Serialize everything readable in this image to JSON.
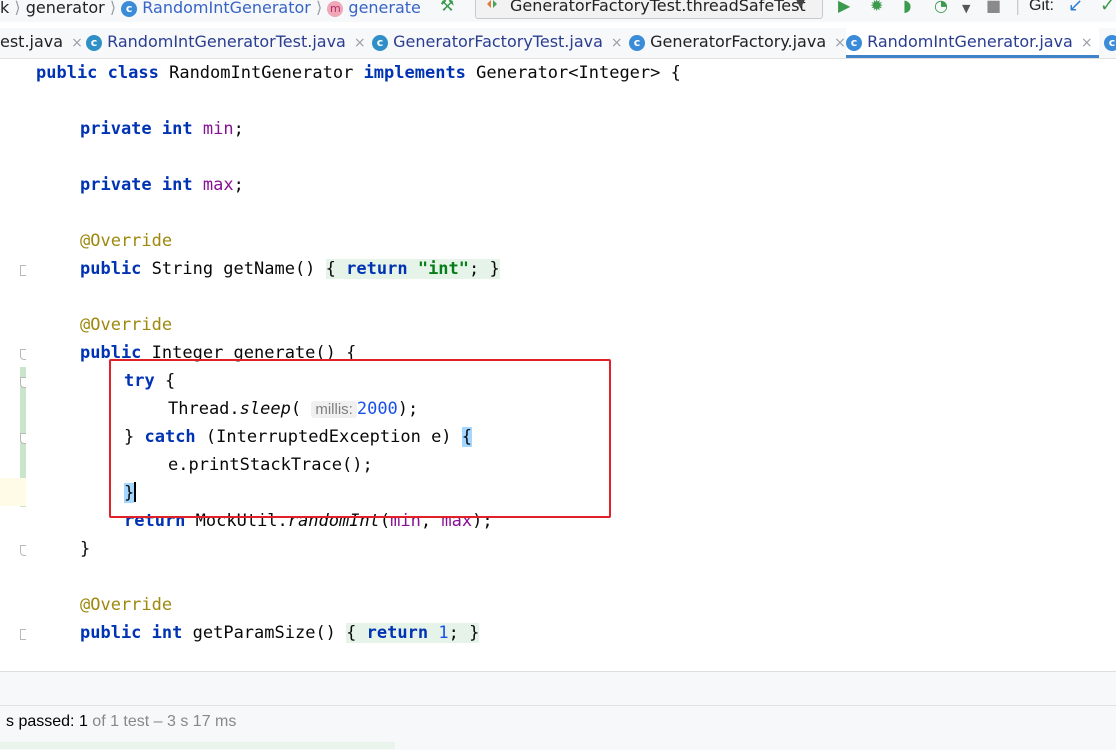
{
  "breadcrumb": {
    "prefix": "k",
    "items": [
      "generator",
      "RandomIntGenerator",
      "generate"
    ],
    "class_badge": "c",
    "method_badge": "m"
  },
  "toolbar": {
    "run_config": "GeneratorFactoryTest.threadSafeTest",
    "vcs_label": "Git:"
  },
  "tabs": [
    {
      "label": "est.java",
      "close": "×"
    },
    {
      "label": "RandomIntGeneratorTest.java",
      "close": "×"
    },
    {
      "label": "GeneratorFactoryTest.java",
      "close": "×"
    },
    {
      "label": "GeneratorFactory.java",
      "close": "×"
    },
    {
      "label": "RandomIntGenerator.java",
      "close": "×"
    }
  ],
  "code": {
    "class_decl": {
      "kw1": "public",
      "kw2": "class",
      "name": " RandomIntGenerator ",
      "kw3": "implements",
      "rest": " Generator<Integer> {"
    },
    "min_decl": {
      "kw1": "private",
      "kw2": "int",
      "field": "min",
      "end": ";"
    },
    "max_decl": {
      "kw1": "private",
      "kw2": "int",
      "field": "max",
      "end": ";"
    },
    "override": "@Override",
    "get_name": {
      "kw1": "public",
      "type": " String getName() ",
      "open": "{",
      "kw2": "return",
      "str": "\"int\"",
      "semi": ";",
      "close": "}"
    },
    "generate_sig": {
      "kw1": "public",
      "rest": " Integer generate() {"
    },
    "try_kw": "try",
    "try_open": " {",
    "sleep": {
      "prefix": "Thread.",
      "method": "sleep",
      "paren": "(",
      "hint": "millis:",
      "value": "2000",
      "end": ");"
    },
    "catch_line": {
      "close": "} ",
      "kw": "catch",
      "rest": " (InterruptedException e) ",
      "open": "{"
    },
    "print": "e.printStackTrace();",
    "catch_close": "}",
    "return_line": {
      "kw": "return",
      "prefix": " MockUtil.",
      "method": "randomInt",
      "open": "(",
      "a": "min",
      "comma": ", ",
      "b": "max",
      "end": ");"
    },
    "method_close": "}",
    "param_size": {
      "kw1": "public",
      "kw2": "int",
      "name": " getParamSize() ",
      "open": "{",
      "kw3": "return",
      "num": "1",
      "semi": ";",
      "close": "}"
    }
  },
  "test_status": {
    "prefix": "s passed: ",
    "count": "1",
    "rest": " of 1 test – 3 s 17 ms"
  }
}
